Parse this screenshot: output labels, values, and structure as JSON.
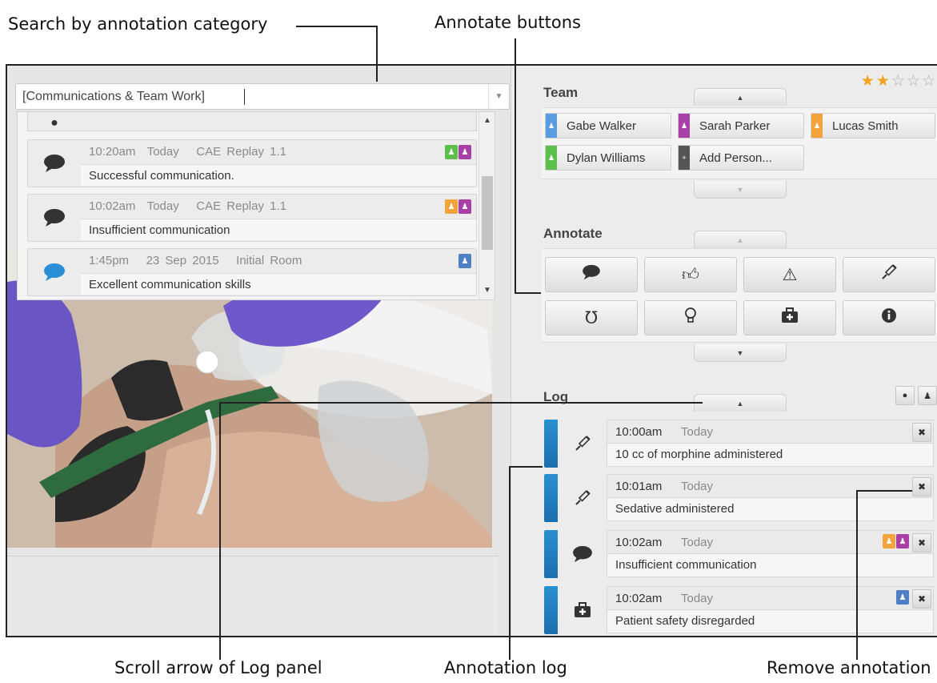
{
  "callouts": {
    "search": "Search by annotation category",
    "annotate_buttons": "Annotate buttons",
    "scroll_arrow": "Scroll arrow of Log panel",
    "annotation_log": "Annotation log",
    "remove_annotation": "Remove annotation"
  },
  "search": {
    "value": "[Communications & Team Work]",
    "results": [
      {
        "time": "10:20am",
        "day": "Today",
        "source": "CAE Replay 1.1",
        "text": "Successful communication.",
        "icon": "speech-bubble-icon",
        "people": [
          "green",
          "purple"
        ]
      },
      {
        "time": "10:02am",
        "day": "Today",
        "source": "CAE Replay 1.1",
        "text": "Insufficient communication",
        "icon": "speech-bubble-icon",
        "people": [
          "orange",
          "purple"
        ]
      },
      {
        "time": "1:45pm",
        "day": "23 Sep 2015",
        "source": "Initial Room",
        "text": "Excellent communication skills",
        "icon": "speech-bubble-icon",
        "people": [
          "blue"
        ]
      }
    ]
  },
  "rating": {
    "value": 2,
    "max": 5
  },
  "team": {
    "title": "Team",
    "members": [
      {
        "name": "Gabe Walker",
        "color": "#5b9be0"
      },
      {
        "name": "Sarah Parker",
        "color": "#a840a8"
      },
      {
        "name": "Lucas Smith",
        "color": "#f2a33a"
      },
      {
        "name": "Dylan Williams",
        "color": "#5cbf4c"
      }
    ],
    "add_label": "Add Person..."
  },
  "annotate": {
    "title": "Annotate",
    "buttons": [
      "speech-bubble-icon",
      "thumbs-up-icon",
      "warning-icon",
      "syringe-icon",
      "stethoscope-icon",
      "lightbulb-icon",
      "first-aid-kit-icon",
      "info-icon"
    ]
  },
  "log": {
    "title": "Log",
    "entries": [
      {
        "time": "10:00am",
        "day": "Today",
        "text": "10 cc of morphine administered",
        "icon": "syringe-icon",
        "people": []
      },
      {
        "time": "10:01am",
        "day": "Today",
        "text": "Sedative administered",
        "icon": "syringe-icon",
        "people": []
      },
      {
        "time": "10:02am",
        "day": "Today",
        "text": "Insufficient communication",
        "icon": "speech-bubble-icon",
        "people": [
          "orange",
          "purple"
        ]
      },
      {
        "time": "10:02am",
        "day": "Today",
        "text": "Patient safety disregarded",
        "icon": "first-aid-kit-icon",
        "people": [
          "blue"
        ]
      }
    ]
  },
  "colors": {
    "log_accent": "#1f7fc2",
    "star": "#f2a31b",
    "green": "#5cbf4c",
    "purple": "#a840a8",
    "orange": "#f2a33a",
    "blue": "#4f7fc4",
    "highlight_bubble": "#2a8fd6"
  }
}
